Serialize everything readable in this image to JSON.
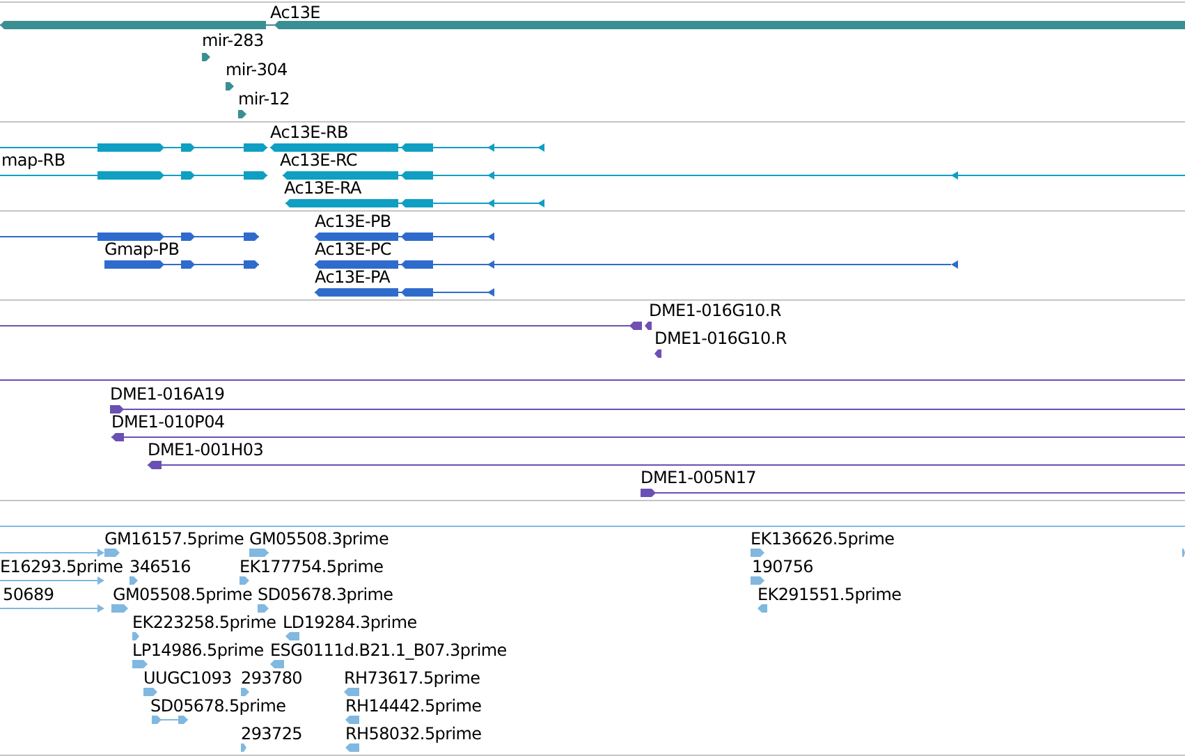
{
  "tracks": [
    {
      "color": "#3a8f92",
      "features": [
        {
          "label": "Ac13E",
          "forward": false
        },
        {
          "label": "mir-283",
          "forward": true
        },
        {
          "label": "mir-304",
          "forward": true
        },
        {
          "label": "mir-12",
          "forward": true
        }
      ]
    },
    {
      "color": "#0f9fc2",
      "features": [
        {
          "forward": true
        },
        {
          "label": "Ac13E-RB",
          "forward": false
        },
        {
          "label": "map-RB",
          "forward": true
        },
        {
          "label": "Ac13E-RC",
          "forward": false
        },
        {
          "label": "Ac13E-RA",
          "forward": false
        }
      ]
    },
    {
      "color": "#2f6bcc",
      "features": [
        {
          "forward": true
        },
        {
          "label": "Ac13E-PB",
          "forward": false
        },
        {
          "label": "Gmap-PB",
          "forward": true
        },
        {
          "label": "Ac13E-PC",
          "forward": false
        },
        {
          "label": "Ac13E-PA",
          "forward": false
        }
      ]
    },
    {
      "color": "#7050b0",
      "features": [
        {
          "forward": false
        },
        {
          "label": "DME1-016G10.R",
          "forward": false
        },
        {
          "label": "DME1-016G10.R",
          "forward": false
        }
      ]
    },
    {
      "color": "#6a4fb5",
      "span": true,
      "features": [
        {
          "label": "DME1-016A19",
          "forward": true
        },
        {
          "label": "DME1-010P04",
          "forward": false
        },
        {
          "label": "DME1-001H03",
          "forward": false
        },
        {
          "label": "DME1-005N17",
          "forward": true
        }
      ]
    },
    {
      "color": "#80b8e0",
      "span": true,
      "features": [
        {
          "forward": true
        },
        {
          "label": "GM16157.5prime",
          "forward": true
        },
        {
          "label": "GM05508.3prime",
          "forward": true
        },
        {
          "label": "EK136626.5prime",
          "forward": true
        },
        {
          "forward": true
        },
        {
          "label": "E16293.5prime",
          "forward": true
        },
        {
          "label": "346516",
          "forward": true
        },
        {
          "label": "EK177754.5prime",
          "forward": true
        },
        {
          "label": "190756",
          "forward": true
        },
        {
          "label": "50689",
          "forward": true
        },
        {
          "label": "GM05508.5prime",
          "forward": true
        },
        {
          "label": "SD05678.3prime",
          "forward": true
        },
        {
          "label": "EK291551.5prime",
          "forward": false
        },
        {
          "label": "EK223258.5prime",
          "forward": true
        },
        {
          "label": "LD19284.3prime",
          "forward": false
        },
        {
          "label": "LP14986.5prime",
          "forward": true
        },
        {
          "label": "ESG0111d.B21.1_B07.3prime",
          "forward": false
        },
        {
          "label": "UUGC1093",
          "forward": true
        },
        {
          "label": "293780",
          "forward": true
        },
        {
          "label": "RH73617.5prime",
          "forward": false
        },
        {
          "label": "SD05678.5prime",
          "forward": true
        },
        {
          "label": "RH14442.5prime",
          "forward": false
        },
        {
          "label": "293725",
          "forward": true
        },
        {
          "label": "RH58032.5prime",
          "forward": false
        }
      ]
    }
  ]
}
